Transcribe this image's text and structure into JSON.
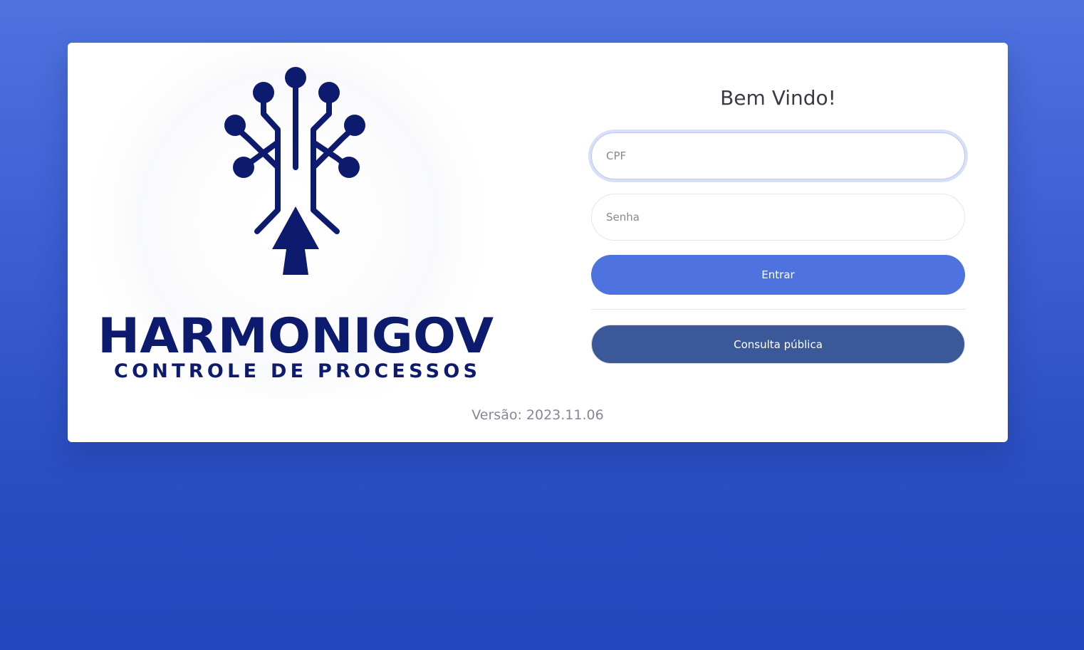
{
  "brand": {
    "logo_icon": "tree-arrow-circuit-icon",
    "name": "HARMONIGOV",
    "tagline": "CONTROLE DE PROCESSOS",
    "color": "#0d1b6e"
  },
  "login": {
    "title": "Bem Vindo!",
    "cpf_placeholder": "CPF",
    "cpf_value": "",
    "password_placeholder": "Senha",
    "password_value": "",
    "submit_label": "Entrar",
    "public_query_label": "Consulta pública"
  },
  "footer": {
    "version_text": "Versão: 2023.11.06"
  },
  "colors": {
    "primary": "#4e73df",
    "secondary": "#3b5998",
    "background_top": "#4e73df",
    "background_bottom": "#2246bb"
  }
}
